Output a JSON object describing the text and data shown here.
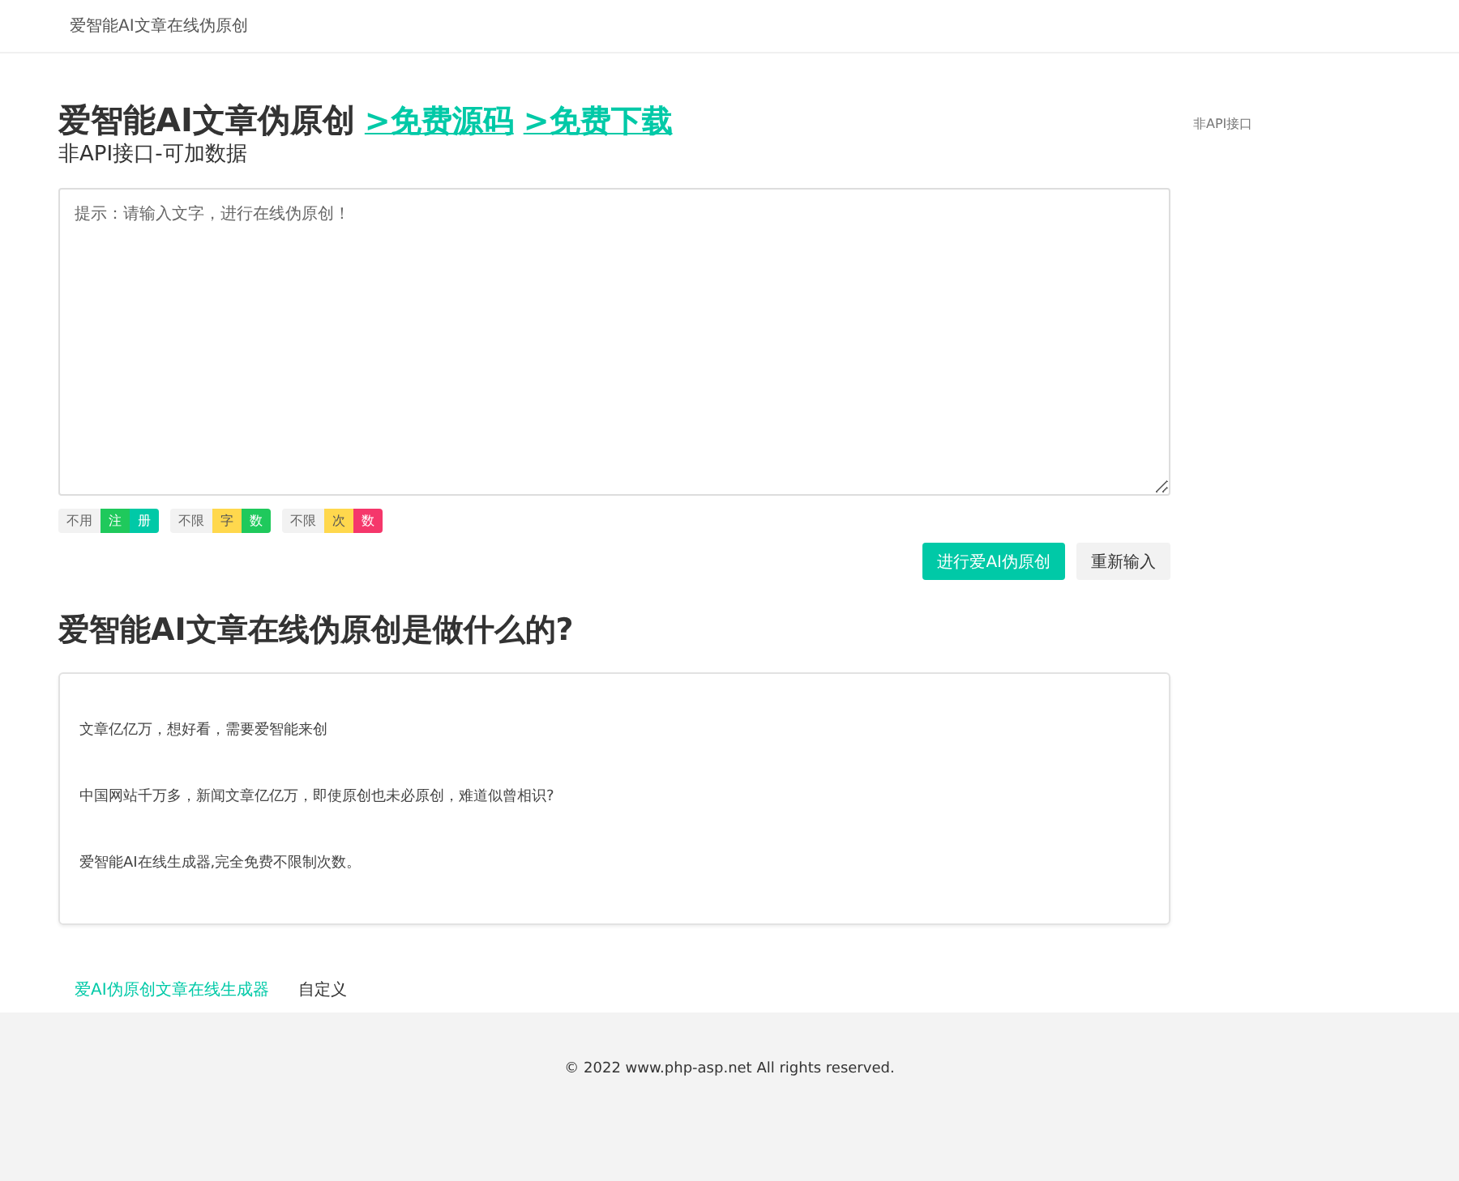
{
  "header": {
    "title": "爱智能AI文章在线伪原创"
  },
  "main": {
    "title": "爱智能AI文章伪原创",
    "links": [
      ">免费源码",
      ">免费下载"
    ],
    "subtitle": "非API接口-可加数据",
    "input": {
      "placeholder": "提示：请输入文字，进行在线伪原创！"
    },
    "badges": [
      {
        "label": "不用",
        "parts": [
          {
            "text": "注",
            "color": "#1fc95c"
          },
          {
            "text": "册",
            "color": "#00c9a7"
          }
        ]
      },
      {
        "label": "不限",
        "parts": [
          {
            "text": "字",
            "color": "#ffd84d"
          },
          {
            "text": "数",
            "color": "#1fc95c"
          }
        ]
      },
      {
        "label": "不限",
        "parts": [
          {
            "text": "次",
            "color": "#ffd84d"
          },
          {
            "text": "数",
            "color": "#f5376b"
          }
        ]
      }
    ],
    "buttons": [
      {
        "label": "进行爱AI伪原创",
        "kind": "primary"
      },
      {
        "label": "重新输入",
        "kind": "plain"
      }
    ],
    "section_title": "爱智能AI文章在线伪原创是做什么的?",
    "paragraphs": [
      "文章亿亿万，想好看，需要爱智能来创",
      "中国网站千万多，新闻文章亿亿万，即使原创也未必原创，难道似曾相识?",
      "爱智能AI在线生成器,完全免费不限制次数。"
    ],
    "footer_links": [
      {
        "label": "爱AI伪原创文章在线生成器",
        "selected": true
      },
      {
        "label": "自定义",
        "selected": false
      }
    ]
  },
  "sidebar": {
    "text": "非API接口"
  },
  "footer": {
    "copyright": "© 2022 www.php-asp.net All rights reserved."
  }
}
